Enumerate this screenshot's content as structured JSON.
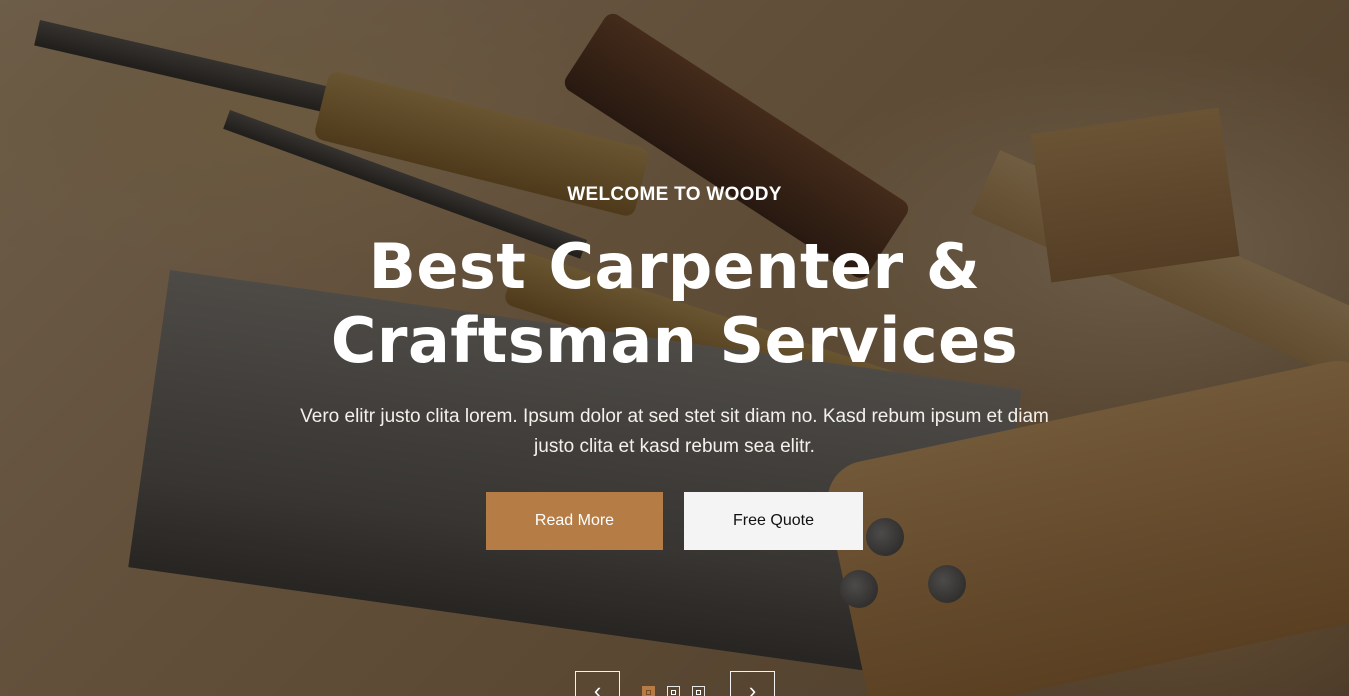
{
  "hero": {
    "eyebrow": "WELCOME TO WOODY",
    "title_line1": "Best Carpenter &",
    "title_line2": "Craftsman Services",
    "lead": "Vero elitr justo clita lorem. Ipsum dolor at sed stet sit diam no. Kasd rebum ipsum et diam justo clita et kasd rebum sea elitr.",
    "buttons": {
      "primary": "Read More",
      "secondary": "Free Quote"
    }
  },
  "carousel": {
    "prev_icon": "chevron-left-icon",
    "next_icon": "chevron-right-icon",
    "prev_glyph": "‹",
    "next_glyph": "›",
    "active_index": 0,
    "dot_count": 3
  },
  "colors": {
    "accent": "#b57d45",
    "light_button": "#f4f4f4",
    "text": "#ffffff"
  }
}
